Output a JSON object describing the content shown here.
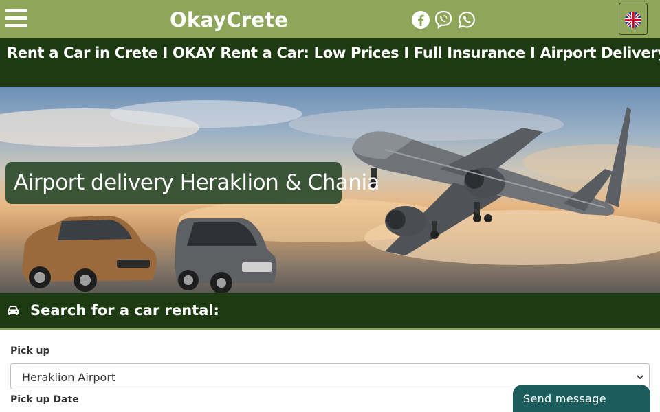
{
  "header": {
    "brand": "OkayCrete",
    "menu_icon": "hamburger-menu-icon",
    "social_icons": [
      "facebook-icon",
      "viber-icon",
      "whatsapp-icon"
    ],
    "language_icon": "uk-flag-icon",
    "background_color": "#8fa65a"
  },
  "headline": {
    "text": "Rent a Car in Crete I OKAY Rent a Car: Low Prices I Full Insurance I Airport Delivery",
    "background_color": "#1e3a12"
  },
  "hero": {
    "caption": "Airport delivery Heraklion & Chania",
    "image_description_icon": "airplane-and-cars-image"
  },
  "search": {
    "title": "Search for a car rental:",
    "icon": "car-icon",
    "pickup_label": "Pick up",
    "pickup_value": "Heraklion Airport",
    "pickup_date_label": "Pick up Date"
  },
  "chat": {
    "label": "Send message",
    "color": "#1d5c5c"
  }
}
